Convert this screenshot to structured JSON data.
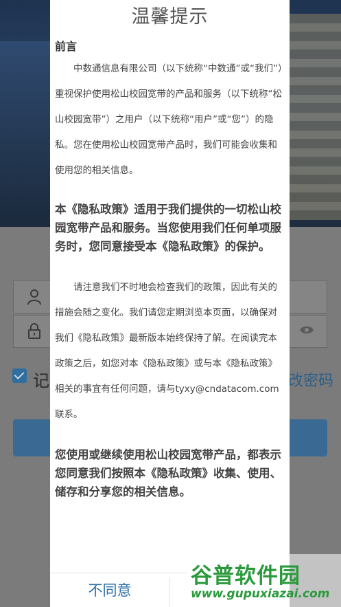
{
  "background": {
    "remember_label": "记",
    "forgot_fragment": "改密码"
  },
  "dialog": {
    "title": "温馨提示",
    "heading": "前言",
    "intro": "中数通信息有限公司（以下统称“中数通”或“我们”）重视保护使用松山校园宽带的产品和服务（以下统称“松山校园宽带”）之用户（以下统称“用户”或“您”）的隐私。您在使用松山校园宽带产品时，我们可能会收集和使用您的相关信息。",
    "scope": "本《隐私政策》适用于我们提供的一切松山校园宽带产品和服务。当您使用我们任何单项服务时，您同意接受本《隐私政策》的保护。",
    "notice": "请注意我们不时地会检查我们的政策，因此有关的措施会随之变化。我们请您定期浏览本页面，以确保对我们《隐私政策》最新版本始终保持了解。在阅读完本政策之后，如您对本《隐私政策》或与本《隐私政策》相关的事宜有任何问题，请与tyxy@cndatacom.com联系。",
    "consent": "您使用或继续使用松山校园宽带产品，都表示您同意我们按照本《隐私政策》收集、使用、储存和分享您的相关信息。",
    "disagree_label": "不同意",
    "agree_label": ""
  },
  "watermark": {
    "title": "谷普软件园",
    "url": "www.gupuxiazai.com"
  },
  "colors": {
    "accent": "#2f6fa8",
    "overlay": "#7b7b7b",
    "watermark": "#2a9a3c"
  },
  "icons": [
    "user-icon",
    "lock-icon",
    "eye-icon",
    "checkbox-checked-icon"
  ]
}
